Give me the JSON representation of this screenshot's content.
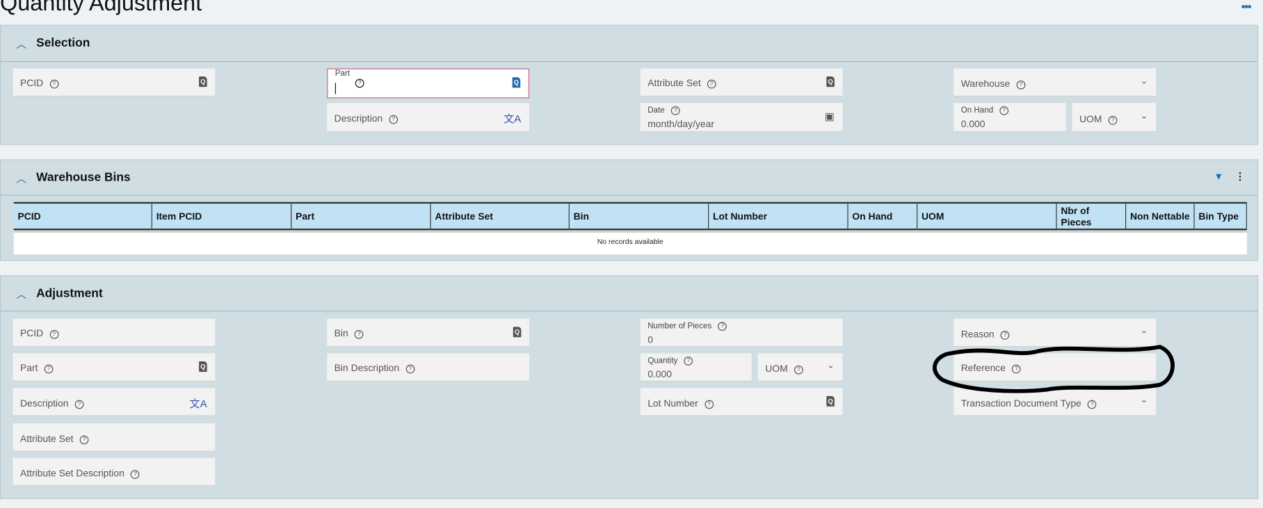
{
  "page": {
    "title": "Quantity Adjustment",
    "more_icon": "more-horizontal-icon"
  },
  "selection": {
    "title": "Selection",
    "fields": {
      "pcid": "PCID",
      "part": "Part",
      "part_value": "",
      "description": "Description",
      "attribute_set": "Attribute Set",
      "date": "Date",
      "date_placeholder": "month/day/year",
      "warehouse": "Warehouse",
      "on_hand": "On Hand",
      "on_hand_value": "0.000",
      "uom": "UOM"
    }
  },
  "bins": {
    "title": "Warehouse Bins",
    "columns": [
      "PCID",
      "Item PCID",
      "Part",
      "Attribute Set",
      "Bin",
      "Lot Number",
      "On Hand",
      "UOM",
      "Nbr of Pieces",
      "Non Nettable",
      "Bin Type"
    ],
    "empty": "No records available"
  },
  "adjustment": {
    "title": "Adjustment",
    "fields": {
      "pcid": "PCID",
      "part": "Part",
      "description": "Description",
      "attribute_set": "Attribute Set",
      "attribute_set_description": "Attribute Set Description",
      "bin": "Bin",
      "bin_description": "Bin Description",
      "number_of_pieces": "Number of Pieces",
      "number_of_pieces_value": "0",
      "quantity": "Quantity",
      "quantity_value": "0.000",
      "uom": "UOM",
      "lot_number": "Lot Number",
      "reason": "Reason",
      "reference": "Reference",
      "transaction_document_type": "Transaction Document Type"
    }
  },
  "colors": {
    "accent": "#2a6e96",
    "panel": "#d0dee3",
    "grid_header": "#c0e2f4",
    "focus_border": "#c06080"
  }
}
